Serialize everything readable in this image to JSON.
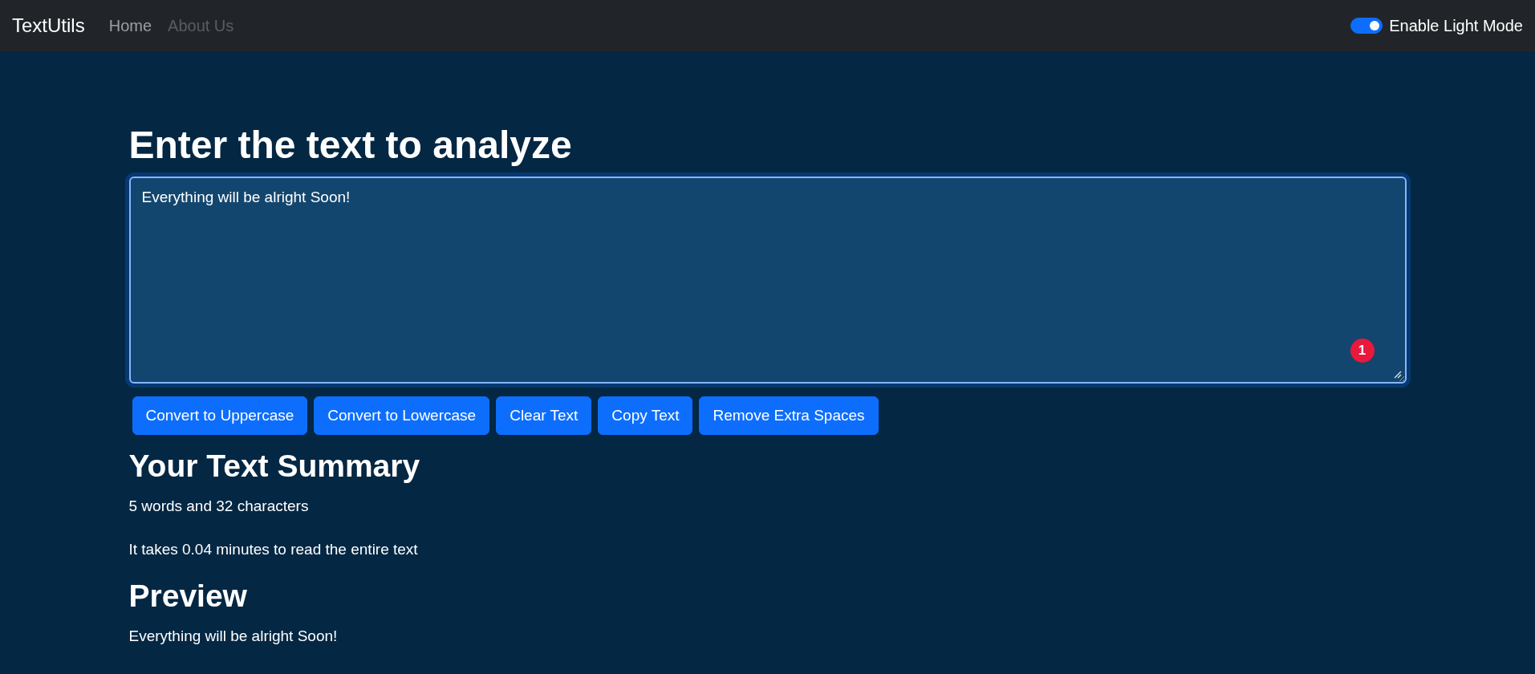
{
  "navbar": {
    "brand": "TextUtils",
    "links": [
      {
        "label": "Home",
        "selected": true
      },
      {
        "label": "About Us",
        "selected": false
      }
    ],
    "mode_switch": {
      "label": "Enable Light Mode",
      "on": true
    }
  },
  "heading": "Enter the text to analyze",
  "textarea": {
    "value": "Everything will be alright Soon!",
    "badge": "1"
  },
  "buttons": [
    "Convert to Uppercase",
    "Convert to Lowercase",
    "Clear Text",
    "Copy Text",
    "Remove Extra Spaces"
  ],
  "summary": {
    "heading": "Your Text Summary",
    "lines": [
      "5 words and 32 characters",
      "It takes 0.04 minutes to read the entire text"
    ]
  },
  "preview": {
    "heading": "Preview",
    "text": "Everything will be alright Soon!"
  }
}
